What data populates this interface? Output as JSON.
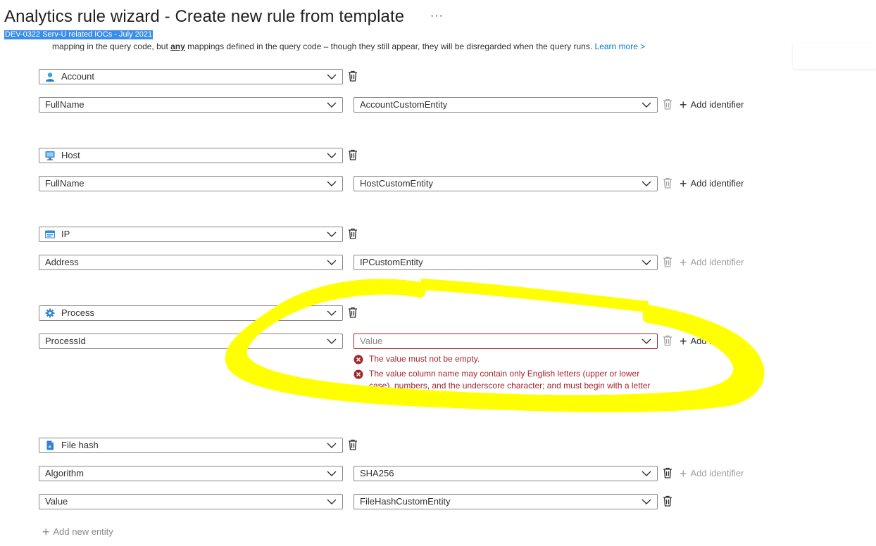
{
  "header": {
    "title": "Analytics rule wizard - Create new rule from template",
    "more_label": "···",
    "subtitle": "DEV-0322 Serv-U related IOCs - July 2021"
  },
  "info": {
    "prefix": "mapping in the query code, but ",
    "bold": "any",
    "suffix": " mappings defined in the query code – though they still appear, they will be disregarded when the query runs. ",
    "link": "Learn more >"
  },
  "add_identifier_label": "Add identifier",
  "add_entity_label": "Add new entity",
  "entities": {
    "account": {
      "type": "Account",
      "identifier": "FullName",
      "value": "AccountCustomEntity"
    },
    "host": {
      "type": "Host",
      "identifier": "FullName",
      "value": "HostCustomEntity"
    },
    "ip": {
      "type": "IP",
      "identifier": "Address",
      "value": "IPCustomEntity"
    },
    "process": {
      "type": "Process",
      "identifier": "ProcessId",
      "value_placeholder": "Value",
      "errors": [
        "The value must not be empty.",
        "The value column name may contain only English letters (upper or lower case), numbers, and the underscore character; and must begin with a letter or an underscore."
      ]
    },
    "filehash": {
      "type": "File hash",
      "identifier1": "Algorithm",
      "value1": "SHA256",
      "identifier2": "Value",
      "value2": "FileHashCustomEntity"
    }
  },
  "colors": {
    "error": "#a4262c",
    "highlight": "#ffff00",
    "accent": "#0078d4",
    "selection": "#3b8ee8"
  }
}
